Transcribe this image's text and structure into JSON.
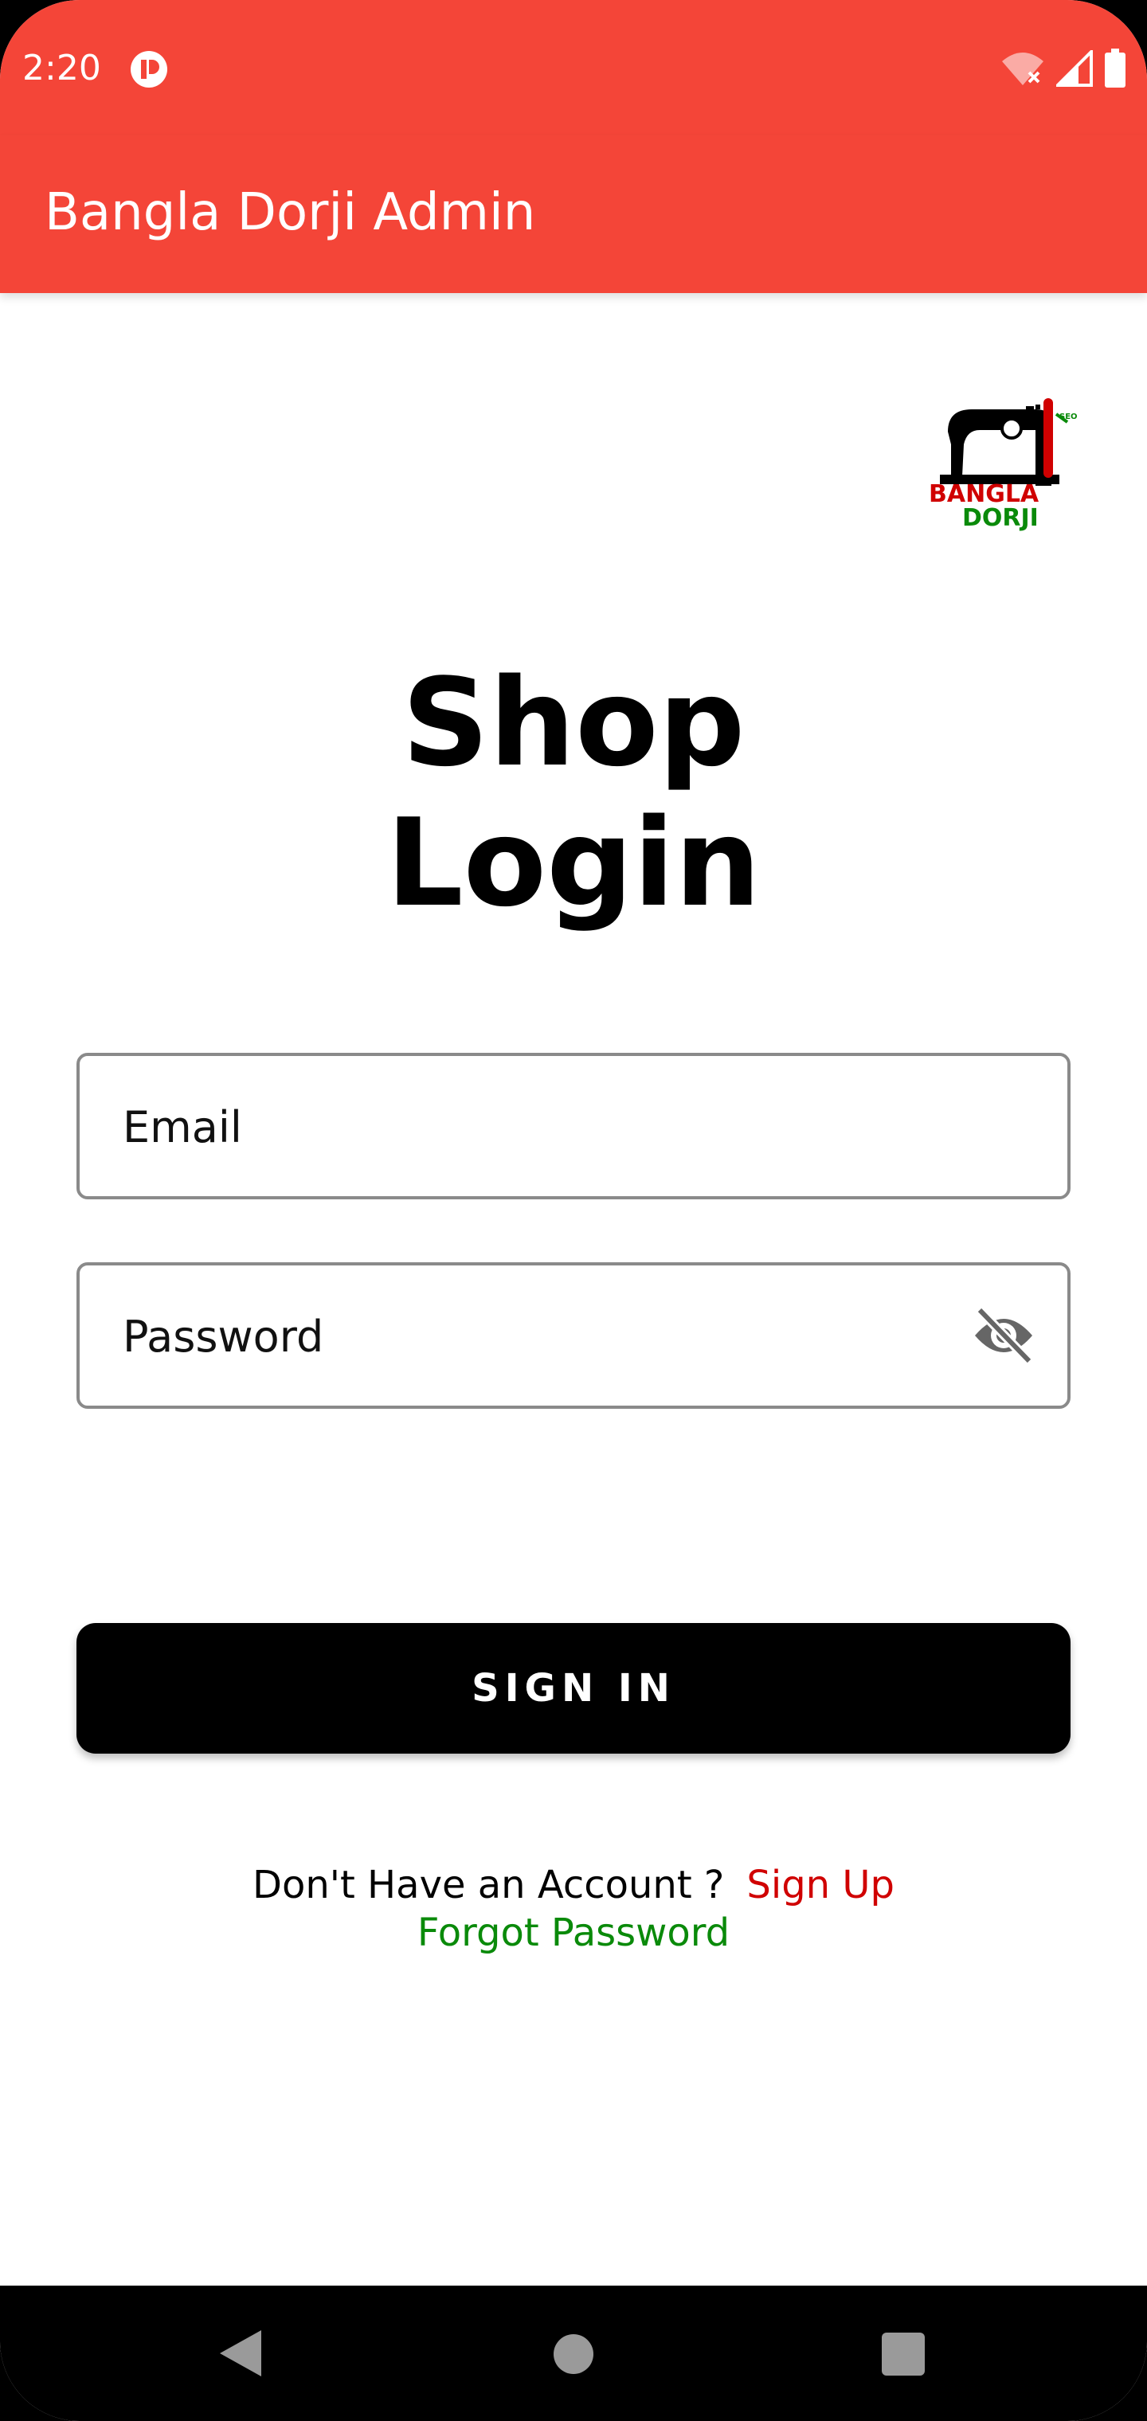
{
  "status_bar": {
    "time": "2:20",
    "icons": [
      "notification-app-icon",
      "wifi-off-icon",
      "signal-icon",
      "battery-icon"
    ]
  },
  "app_bar": {
    "title": "Bangla Dorji Admin"
  },
  "logo": {
    "name": "bangla-dorji-sewing-machine-logo",
    "text_line1": "BANGLA",
    "text_line2": "DORJI"
  },
  "page": {
    "title_line1": "Shop",
    "title_line2": "Login"
  },
  "form": {
    "email_placeholder": "Email",
    "email_value": "",
    "password_placeholder": "Password",
    "password_value": "",
    "password_toggle_icon": "eye-off-icon"
  },
  "actions": {
    "sign_in_label": "SIGN IN",
    "no_account_text": "Don't Have an Account ?",
    "sign_up_label": "Sign Up",
    "forgot_password_label": "Forgot Password"
  },
  "colors": {
    "primary": "#f44538",
    "button": "#000000",
    "sign_up": "#d00000",
    "forgot_password": "#0a8a0a"
  },
  "nav_bar": {
    "icons": [
      "back-icon",
      "home-icon",
      "recents-icon"
    ]
  }
}
